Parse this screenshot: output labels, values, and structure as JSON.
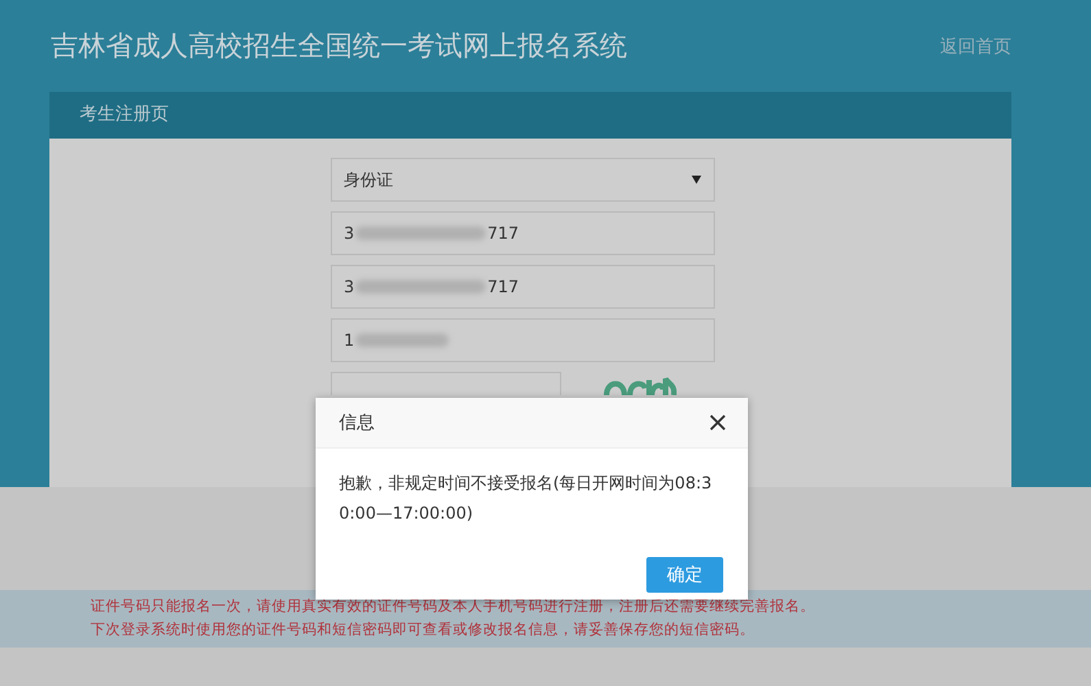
{
  "header": {
    "title": "吉林省成人高校招生全国统一考试网上报名系统",
    "home_link": "返回首页"
  },
  "panel": {
    "title": "考生注册页"
  },
  "form": {
    "id_type": "身份证",
    "fields": [
      {
        "prefix": "3",
        "suffix": "717",
        "masked": true
      },
      {
        "prefix": "3",
        "suffix": "717",
        "masked": true
      },
      {
        "prefix": "1",
        "masked": true
      }
    ]
  },
  "notice": [
    "证件号码只能报名一次，请使用真实有效的证件号码及本人手机号码进行注册，注册后还需要继续完善报名。",
    "下次登录系统时使用您的证件号码和短信密码即可查看或修改报名信息，请妥善保存您的短信密码。"
  ],
  "dialog": {
    "title": "信息",
    "message": "抱歉，非规定时间不接受报名(每日开网时间为08:30:00—17:00:00)",
    "button": "确定"
  }
}
